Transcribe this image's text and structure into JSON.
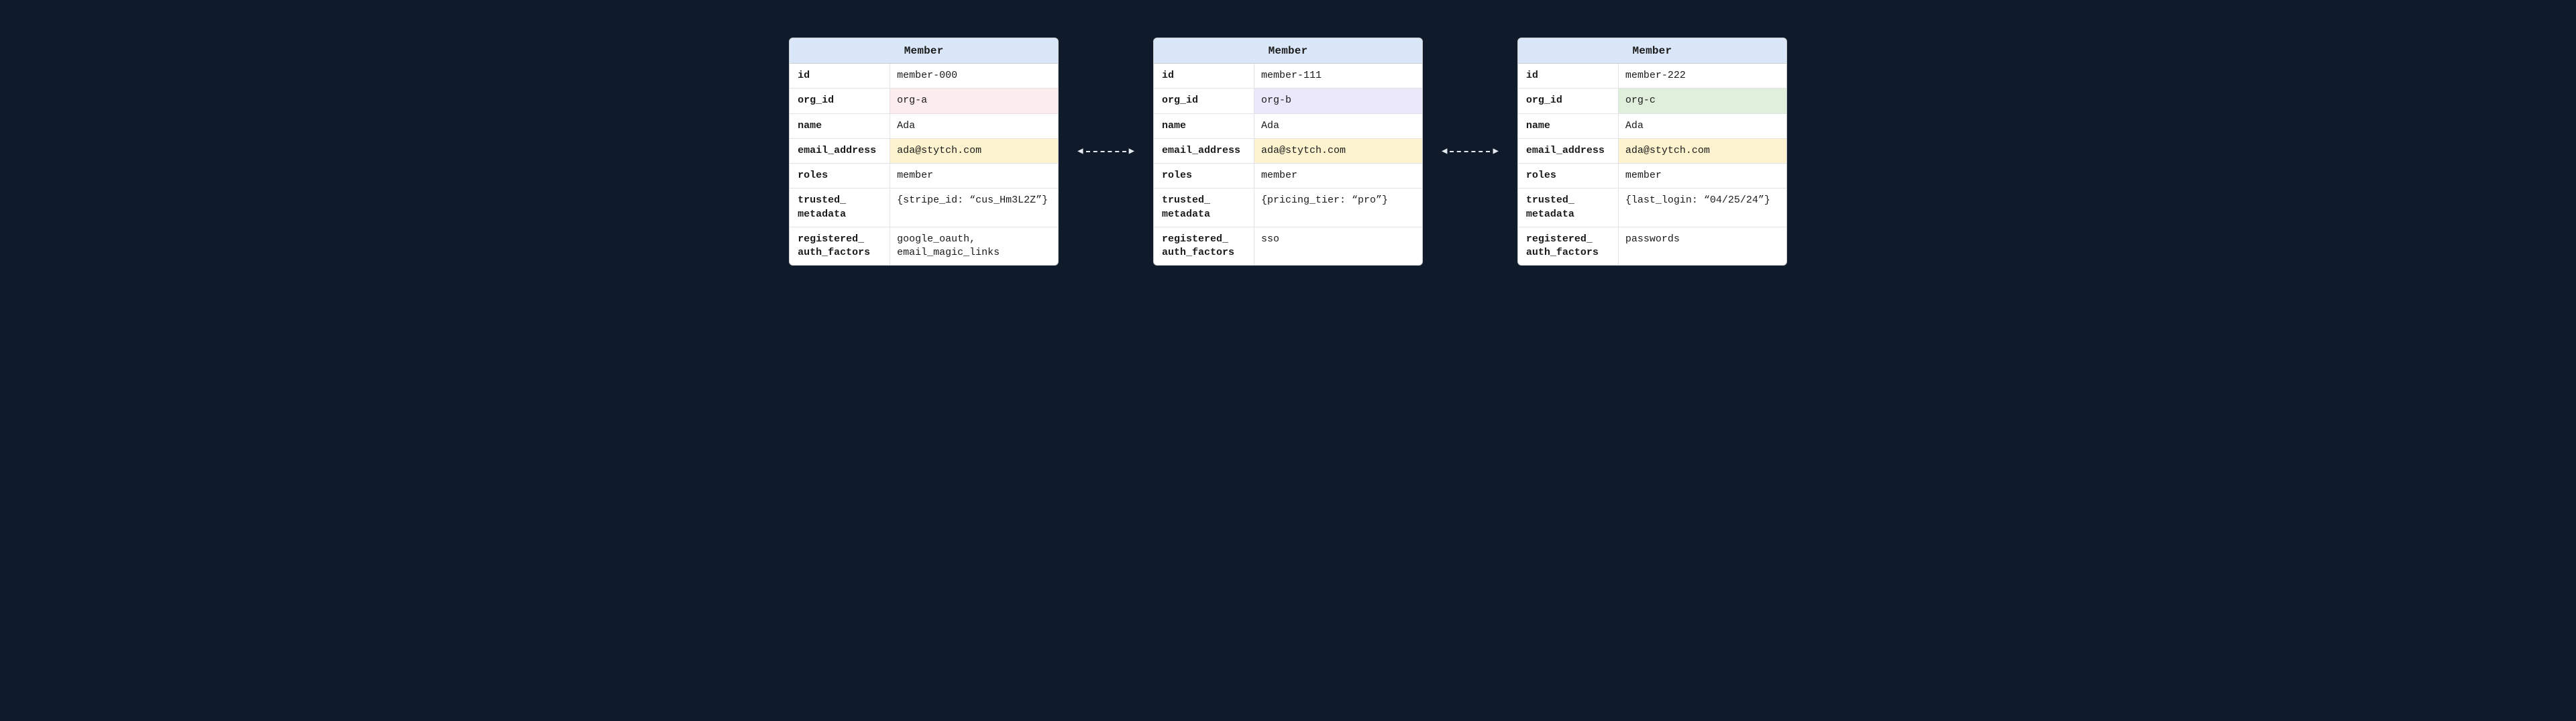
{
  "header_label": "Member",
  "highlight_classes": {
    "pink": "hl-pink",
    "purple": "hl-purple",
    "green": "hl-green",
    "yellow": "hl-yellow"
  },
  "cards": [
    {
      "org_highlight": "pink",
      "fields": {
        "id": {
          "key": "id",
          "value": "member-000"
        },
        "org_id": {
          "key": "org_id",
          "value": "org-a"
        },
        "name": {
          "key": "name",
          "value": "Ada"
        },
        "email": {
          "key": "email_address",
          "value": "ada@stytch.com"
        },
        "roles": {
          "key": "roles",
          "value": "member"
        },
        "metadata": {
          "key": "trusted_ metadata",
          "value": "{stripe_id: “cus_Hm3L2Z”}"
        },
        "auth_factors": {
          "key": "registered_ auth_factors",
          "value": "google_oauth, email_magic_links"
        }
      }
    },
    {
      "org_highlight": "purple",
      "fields": {
        "id": {
          "key": "id",
          "value": "member-111"
        },
        "org_id": {
          "key": "org_id",
          "value": "org-b"
        },
        "name": {
          "key": "name",
          "value": "Ada"
        },
        "email": {
          "key": "email_address",
          "value": "ada@stytch.com"
        },
        "roles": {
          "key": "roles",
          "value": "member"
        },
        "metadata": {
          "key": "trusted_ metadata",
          "value": "{pricing_tier: “pro”}"
        },
        "auth_factors": {
          "key": "registered_ auth_factors",
          "value": "sso"
        }
      }
    },
    {
      "org_highlight": "green",
      "fields": {
        "id": {
          "key": "id",
          "value": "member-222"
        },
        "org_id": {
          "key": "org_id",
          "value": "org-c"
        },
        "name": {
          "key": "name",
          "value": "Ada"
        },
        "email": {
          "key": "email_address",
          "value": "ada@stytch.com"
        },
        "roles": {
          "key": "roles",
          "value": "member"
        },
        "metadata": {
          "key": "trusted_ metadata",
          "value": "{last_login: “04/25/24”}"
        },
        "auth_factors": {
          "key": "registered_ auth_factors",
          "value": "passwords"
        }
      }
    }
  ]
}
